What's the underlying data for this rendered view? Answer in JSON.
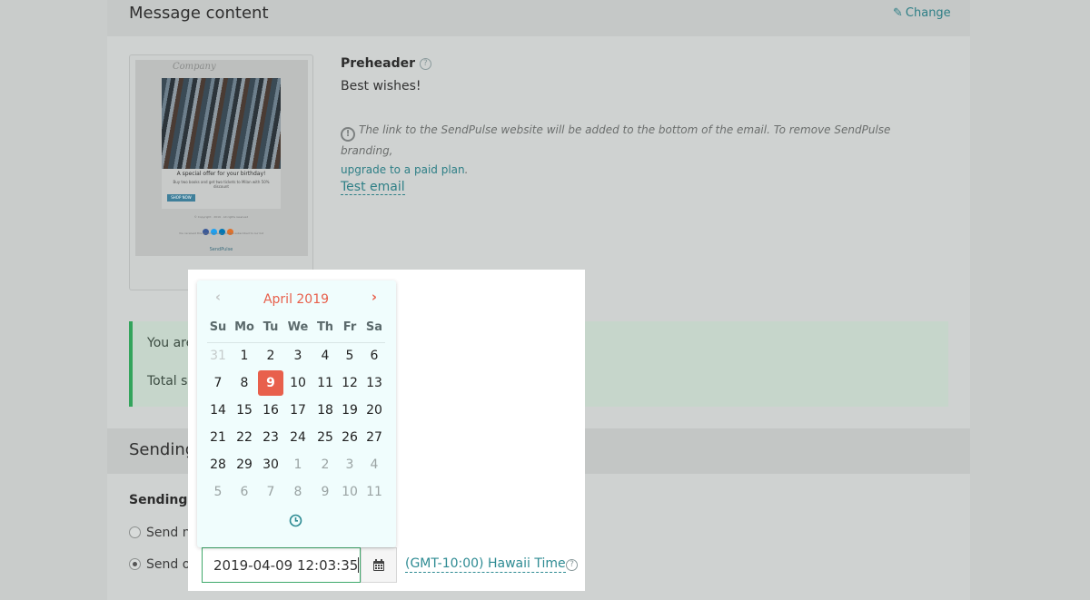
{
  "message": {
    "section_title": "Message content",
    "change_label": "Change",
    "preview": {
      "company": "Company",
      "offer_title": "A special offer for your birthday!",
      "offer_sub": "Buy two books and get two tickets to Milan with 50% discount",
      "shop_button": "SHOP NOW",
      "copyright": "© Copyright · 2019 · All rights reserved",
      "footer": "You received this email because you are subscribed to our list",
      "brand": "SendPulse"
    },
    "preheader_label": "Preheader",
    "preheader_value": "Best wishes!",
    "notice_text": "The link to the SendPulse website will be added to the bottom of the email. To remove SendPulse branding,",
    "notice_link": "upgrade to a paid plan",
    "test_email": "Test email",
    "status_line1": "You are g",
    "status_line2": "Total siz"
  },
  "sending": {
    "title": "Sending",
    "time_label": "Sending ti",
    "option_now": "Send no",
    "option_on": "Send on",
    "selected_option": "Send on",
    "datetime_value": "2019-04-09 12:03:35",
    "timezone": "(GMT-10:00) Hawaii Time"
  },
  "datepicker": {
    "month_label": "April 2019",
    "weekdays": [
      "Su",
      "Mo",
      "Tu",
      "We",
      "Th",
      "Fr",
      "Sa"
    ],
    "weeks": [
      [
        "31",
        "1",
        "2",
        "3",
        "4",
        "5",
        "6"
      ],
      [
        "7",
        "8",
        "9",
        "10",
        "11",
        "12",
        "13"
      ],
      [
        "14",
        "15",
        "16",
        "17",
        "18",
        "19",
        "20"
      ],
      [
        "21",
        "22",
        "23",
        "24",
        "25",
        "26",
        "27"
      ],
      [
        "28",
        "29",
        "30",
        "1",
        "2",
        "3",
        "4"
      ],
      [
        "5",
        "6",
        "7",
        "8",
        "9",
        "10",
        "11"
      ]
    ],
    "selected_day": "9",
    "accent_color": "#e8604c",
    "link_color": "#2e8b93"
  },
  "icons": {
    "pencil": "pencil-icon",
    "help": "help-circle-icon",
    "warning": "exclamation-circle-icon",
    "calendar": "calendar-icon",
    "clock": "clock-icon",
    "prev": "chevron-left-icon",
    "next": "chevron-right-icon"
  }
}
